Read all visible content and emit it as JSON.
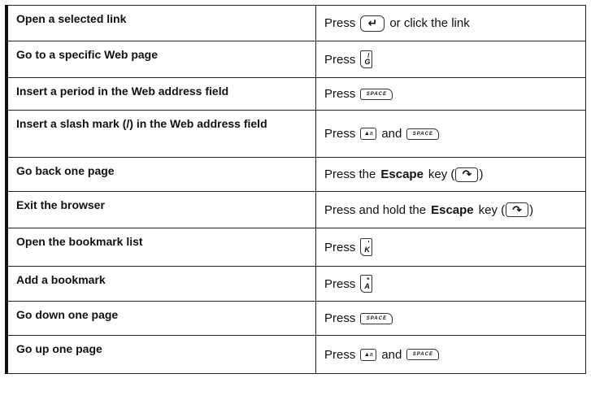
{
  "rows": [
    {
      "action": "Open a selected link",
      "press": "Press",
      "after": "or click the link",
      "keys": {
        "first": "enter-key"
      }
    },
    {
      "action": "Go to a specific Web page",
      "press": "Press",
      "keys": {
        "first": "g-key",
        "sym": "/",
        "letter": "G"
      }
    },
    {
      "action": "Insert a period in the Web address field",
      "press": "Press",
      "keys": {
        "first": "space-key",
        "label": "SPACE"
      }
    },
    {
      "action": "Insert a slash mark (/) in the Web address field",
      "press": "Press",
      "conj": "and",
      "keys": {
        "first": "alt-key",
        "second": "space-key",
        "label": "SPACE"
      }
    },
    {
      "action": "Go back one page",
      "prefix": "Press the",
      "key_word": "Escape",
      "suffix": "key (",
      "close": ")",
      "keys": {
        "first": "escape-key"
      }
    },
    {
      "action": "Exit the browser",
      "prefix": "Press and hold the",
      "key_word": "Escape",
      "suffix": "key (",
      "close": ")",
      "keys": {
        "first": "escape-key"
      }
    },
    {
      "action": "Open the bookmark list",
      "press": "Press",
      "keys": {
        "first": "k-key",
        "sym": "'",
        "letter": "K"
      }
    },
    {
      "action": "Add a bookmark",
      "press": "Press",
      "keys": {
        "first": "a-key",
        "sym": "*",
        "letter": "A"
      }
    },
    {
      "action": "Go down one page",
      "press": "Press",
      "keys": {
        "first": "space-key",
        "label": "SPACE"
      }
    },
    {
      "action": "Go up one page",
      "press": "Press",
      "conj": "and",
      "keys": {
        "first": "alt-key",
        "second": "space-key",
        "label": "SPACE"
      }
    }
  ]
}
